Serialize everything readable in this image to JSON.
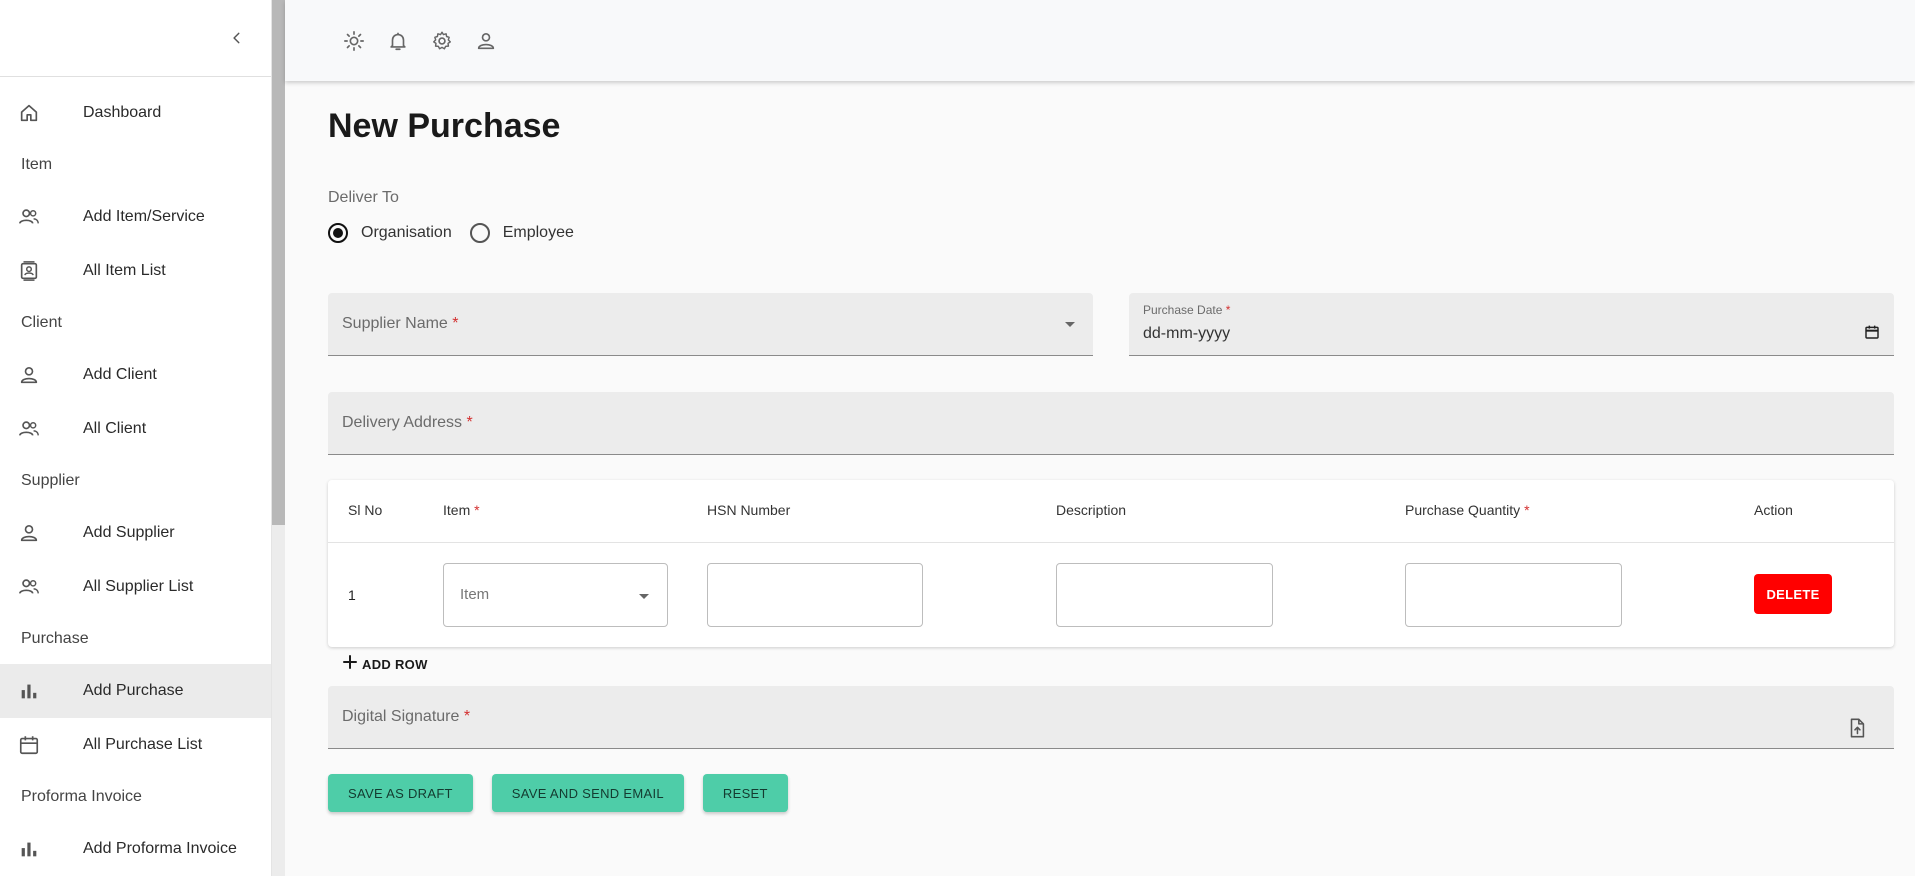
{
  "sidebar": {
    "items": [
      {
        "type": "item",
        "label": "Dashboard",
        "icon": "home-icon"
      },
      {
        "type": "section",
        "label": "Item"
      },
      {
        "type": "item",
        "label": "Add Item/Service",
        "icon": "users-icon"
      },
      {
        "type": "item",
        "label": "All Item List",
        "icon": "contact-card-icon"
      },
      {
        "type": "section",
        "label": "Client"
      },
      {
        "type": "item",
        "label": "Add Client",
        "icon": "user-icon"
      },
      {
        "type": "item",
        "label": "All Client",
        "icon": "users-icon"
      },
      {
        "type": "section",
        "label": "Supplier"
      },
      {
        "type": "item",
        "label": "Add Supplier",
        "icon": "user-icon"
      },
      {
        "type": "item",
        "label": "All Supplier List",
        "icon": "users-icon"
      },
      {
        "type": "section",
        "label": "Purchase"
      },
      {
        "type": "item",
        "label": "Add Purchase",
        "icon": "bar-chart-icon",
        "active": true
      },
      {
        "type": "item",
        "label": "All Purchase List",
        "icon": "calendar-icon"
      },
      {
        "type": "section",
        "label": "Proforma Invoice"
      },
      {
        "type": "item",
        "label": "Add Proforma Invoice",
        "icon": "bar-chart-icon"
      }
    ]
  },
  "topbar": {
    "icons": [
      "sun-icon",
      "bell-icon",
      "gear-icon",
      "user-icon"
    ]
  },
  "page": {
    "title": "New Purchase"
  },
  "deliver_to": {
    "label": "Deliver To",
    "options": [
      "Organisation",
      "Employee"
    ],
    "selected": "Organisation"
  },
  "form": {
    "supplier_name": {
      "label": "Supplier Name",
      "required_mark": "*"
    },
    "purchase_date": {
      "label": "Purchase Date",
      "required_mark": "*",
      "placeholder": "dd-mm-yyyy"
    },
    "delivery_address": {
      "label": "Delivery Address",
      "required_mark": "*"
    },
    "digital_signature": {
      "label": "Digital Signature",
      "required_mark": "*"
    }
  },
  "table": {
    "headers": {
      "sl_no": "Sl No",
      "item": "Item",
      "hsn": "HSN Number",
      "description": "Description",
      "quantity": "Purchase Quantity",
      "action": "Action"
    },
    "required_mark": "*",
    "rows": [
      {
        "sl_no": "1",
        "item_placeholder": "Item",
        "hsn": "",
        "description": "",
        "quantity": ""
      }
    ],
    "delete_label": "DELETE",
    "add_row_label": "ADD ROW"
  },
  "actions": {
    "save_draft": "SAVE AS DRAFT",
    "save_email": "SAVE AND SEND EMAIL",
    "reset": "RESET"
  },
  "colors": {
    "accent": "#4ecda8",
    "danger": "#ff0000",
    "active_bg": "#ebebeb"
  }
}
